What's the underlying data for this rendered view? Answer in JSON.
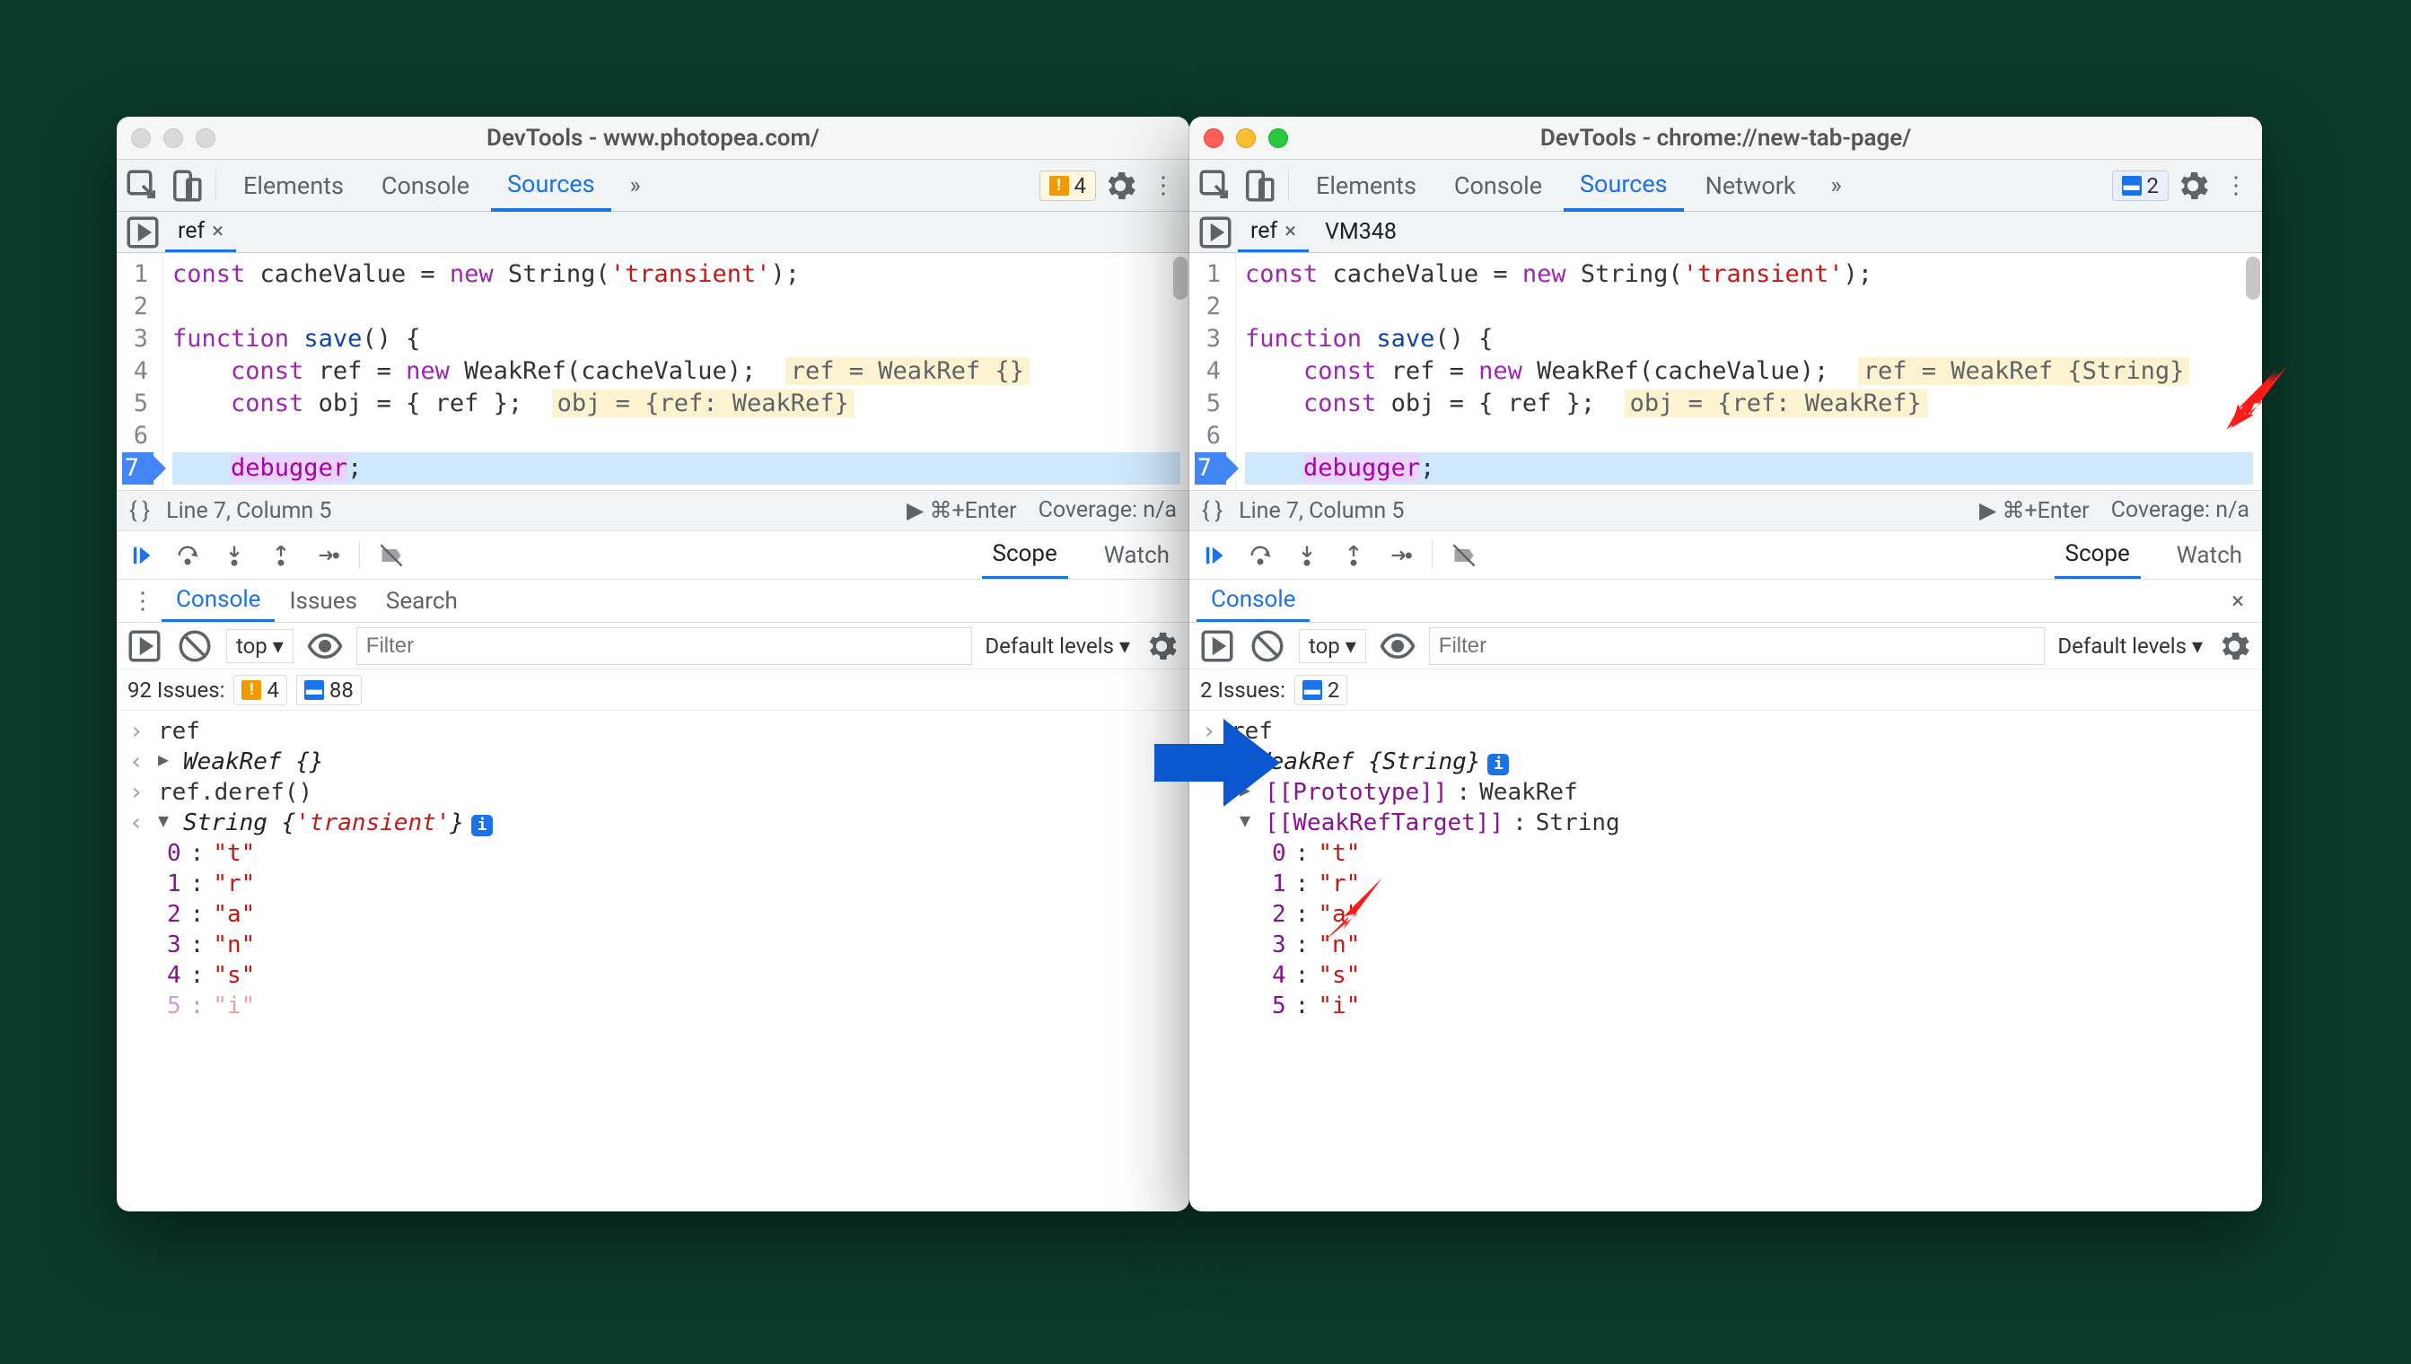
{
  "left": {
    "title": "DevTools - www.photopea.com/",
    "tabs": [
      "Elements",
      "Console",
      "Sources"
    ],
    "activeTab": "Sources",
    "badgeCount": "4",
    "fileTabs": [
      {
        "name": "ref",
        "active": true
      }
    ],
    "code": {
      "lines": [
        {
          "n": "1",
          "html": "<span class='kw'>const</span> cacheValue = <span class='new'>new</span> String(<span class='str'>'transient'</span>);"
        },
        {
          "n": "2",
          "html": ""
        },
        {
          "n": "3",
          "html": "<span class='kw'>function</span> <span class='fn'>save</span>() {"
        },
        {
          "n": "4",
          "html": "    <span class='kw'>const</span> ref = <span class='new'>new</span> WeakRef(cacheValue);  <span class='inline-eval'>ref = WeakRef {}</span>"
        },
        {
          "n": "5",
          "html": "    <span class='kw'>const</span> obj = { ref };  <span class='inline-eval'>obj = {ref: WeakRef}</span>"
        },
        {
          "n": "6",
          "html": ""
        },
        {
          "n": "7",
          "html": "    <span class='dbg'>debugger</span>;",
          "bp": true,
          "hl": true
        }
      ]
    },
    "cursor": "Line 7, Column 5",
    "run": "⌘+Enter",
    "coverage": "Coverage: n/a",
    "scopeTabs": [
      "Scope",
      "Watch"
    ],
    "drawerTabs": [
      "Console",
      "Issues",
      "Search"
    ],
    "filter": {
      "ctx": "top ▾",
      "placeholder": "Filter",
      "levels": "Default levels ▾"
    },
    "issues": {
      "text": "92 Issues:",
      "warn": "4",
      "info": "88"
    },
    "console": [
      {
        "type": "in",
        "text": "ref"
      },
      {
        "type": "out",
        "expand": "▶",
        "html": "<span class='obj'>WeakRef {}</span>"
      },
      {
        "type": "in",
        "text": "ref.deref()"
      },
      {
        "type": "out",
        "expand": "▼",
        "html": "<span class='obj'>String {<span class='val'>'transient'</span>}</span><span class='info-badge'>i</span>"
      },
      {
        "type": "kv",
        "k": "0",
        "v": "\"t\""
      },
      {
        "type": "kv",
        "k": "1",
        "v": "\"r\""
      },
      {
        "type": "kv",
        "k": "2",
        "v": "\"a\""
      },
      {
        "type": "kv",
        "k": "3",
        "v": "\"n\""
      },
      {
        "type": "kv",
        "k": "4",
        "v": "\"s\""
      },
      {
        "type": "kv",
        "k": "5",
        "v": "\"i\"",
        "faded": true
      }
    ]
  },
  "right": {
    "title": "DevTools - chrome://new-tab-page/",
    "tabs": [
      "Elements",
      "Console",
      "Sources",
      "Network"
    ],
    "activeTab": "Sources",
    "badgeCount": "2",
    "fileTabs": [
      {
        "name": "ref",
        "active": true
      },
      {
        "name": "VM348",
        "active": false
      }
    ],
    "code": {
      "lines": [
        {
          "n": "1",
          "html": "<span class='kw'>const</span> cacheValue = <span class='new'>new</span> String(<span class='str'>'transient'</span>);"
        },
        {
          "n": "2",
          "html": ""
        },
        {
          "n": "3",
          "html": "<span class='kw'>function</span> <span class='fn'>save</span>() {"
        },
        {
          "n": "4",
          "html": "    <span class='kw'>const</span> ref = <span class='new'>new</span> WeakRef(cacheValue);  <span class='inline-eval'>ref = WeakRef {String}</span>"
        },
        {
          "n": "5",
          "html": "    <span class='kw'>const</span> obj = { ref };  <span class='inline-eval'>obj = {ref: WeakRef}</span>"
        },
        {
          "n": "6",
          "html": ""
        },
        {
          "n": "7",
          "html": "    <span class='dbg'>debugger</span>;",
          "bp": true,
          "hl": true
        }
      ]
    },
    "cursor": "Line 7, Column 5",
    "run": "⌘+Enter",
    "coverage": "Coverage: n/a",
    "scopeTabs": [
      "Scope",
      "Watch"
    ],
    "drawerTabs": [
      "Console"
    ],
    "filter": {
      "ctx": "top ▾",
      "placeholder": "Filter",
      "levels": "Default levels ▾"
    },
    "issues": {
      "text": "2 Issues:",
      "info": "2"
    },
    "console": [
      {
        "type": "in",
        "text": "ref"
      },
      {
        "type": "out",
        "expand": "▼",
        "html": "<span class='obj'>WeakRef {String}</span><span class='info-badge'>i</span>"
      },
      {
        "type": "slot",
        "expand": "▶",
        "k": "[[Prototype]]",
        "v": "WeakRef"
      },
      {
        "type": "slot",
        "expand": "▼",
        "k": "[[WeakRefTarget]]",
        "v": "String"
      },
      {
        "type": "kv2",
        "k": "0",
        "v": "\"t\""
      },
      {
        "type": "kv2",
        "k": "1",
        "v": "\"r\""
      },
      {
        "type": "kv2",
        "k": "2",
        "v": "\"a\""
      },
      {
        "type": "kv2",
        "k": "3",
        "v": "\"n\""
      },
      {
        "type": "kv2",
        "k": "4",
        "v": "\"s\""
      },
      {
        "type": "kv2",
        "k": "5",
        "v": "\"i\""
      }
    ]
  }
}
